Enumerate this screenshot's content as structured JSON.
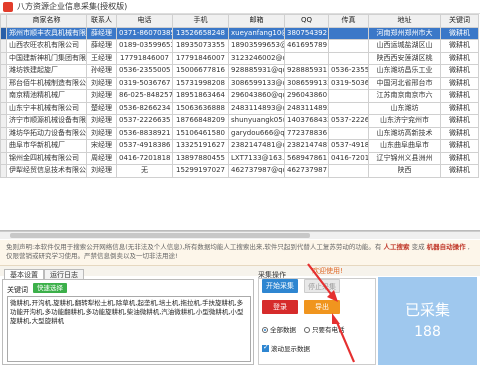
{
  "window": {
    "title": "八方资源企业信息采集(授权版)"
  },
  "table": {
    "columns": [
      "商家名称",
      "联系人",
      "电话",
      "手机",
      "邮箱",
      "QQ",
      "传真",
      "地址",
      "关键词"
    ],
    "rows": [
      [
        "郑州市顺丰农具机械有限公司",
        "薛经理",
        "0371-86070385",
        "13526658248",
        "xueyanfang10@qq",
        "380754392",
        "",
        "河南郑州郑州市大",
        "微耕机"
      ],
      [
        "山西农旺农机有限公司",
        "薛经理",
        "0189-03599653",
        "18935073355",
        "18903599653@",
        "461695789",
        "",
        "山西运城盐湖区山",
        "微耕机"
      ],
      [
        "中国建新神机门集团有限",
        "王经理",
        "17791846007",
        "17791846007",
        "3123246002@qq",
        "",
        "",
        "陕西西安莲湖区桃",
        "微耕机"
      ],
      [
        "潍坊铁建起旋厂",
        "孙经理",
        "0536-2355005",
        "15006677816",
        "928885931@qq.",
        "928885931",
        "0536-235500",
        "山东潍坊昌乐工业",
        "微耕机"
      ],
      [
        "邢台佰牛机械制造有限公司",
        "刘经理",
        "0319-5036767",
        "15731998208",
        "3086599133@qq",
        "3086599133",
        "0319-503676",
        "中国河北省邢台市",
        "微耕机"
      ],
      [
        "南京精池精机械厂",
        "刘经理",
        "86-025-8482578",
        "18951863464",
        "296043860@qq",
        "296043860",
        "",
        "江苏南京南京市六",
        "微耕机"
      ],
      [
        "山东宁丰机械有限公司",
        "楚经理",
        "0536-8266234",
        "15063636888",
        "2483114893@qq",
        "2483114893",
        "",
        "山东潍坊",
        "微耕机"
      ],
      [
        "济宁市顺源机械设备有限",
        "刘经理",
        "0537-2226635",
        "18766848209",
        "shunyuangk05@",
        "1403768432",
        "0537-222663",
        "山东济宁兖州市",
        "微耕机"
      ],
      [
        "潍坊华拓动力设备有限公",
        "刘经理",
        "0536-8838921",
        "15106461580",
        "garydou666@qq",
        "772378836",
        "",
        "山东潍坊高新技术",
        "微耕机"
      ],
      [
        "曲阜市华新机械厂",
        "宋经理",
        "0537-4918386",
        "13325191627",
        "2382147481@qq",
        "2382147481",
        "0537-491838",
        "山东曲阜曲阜市",
        "微耕机"
      ],
      [
        "锦州金四机械有限公司",
        "周经理",
        "0416-7201818",
        "13897880455",
        "LXT7133@163.C",
        "568947861",
        "0416-720181",
        "辽宁锦州义县洲州",
        "微耕机"
      ],
      [
        "伊犁经贸信息技术有限公",
        "刘经理",
        "无",
        "15299197027",
        "462737987@qq",
        "462737987",
        "",
        "陕西",
        "微耕机"
      ]
    ],
    "selected_row": 0
  },
  "disclaimer": {
    "line1": "免则声明:本软件仅用于搜索公开网络信息(无非法及个人信息),所有数据均能人工搜索出来,软件只起到代替人工复苏劳动的功能。有",
    "highlight1": "人工搜索",
    "mid": "变成",
    "highlight2": "机器自动操作",
    "line2_rest": ",仅限营销或研究学习使用。严禁信息倒卖以及一切非法用途!",
    "welcome": "欢迎使用!"
  },
  "tabs": [
    {
      "label": "基本设置",
      "active": true
    },
    {
      "label": "运行日志",
      "active": false
    }
  ],
  "settings": {
    "keyword_label": "关键词",
    "quick_button": "快速选择",
    "keywords": "微耕机,开沟机,旋耕机,翻转犁松土机,除草机,起垄机,培土机,拖拉机,手扶旋耕机,多功能开沟机,多功能翻耕机,多功能旋耕机,柴油微耕机,汽油微耕机,小型微耕机,小型旋耕机,大型旋耕机"
  },
  "ops": {
    "label": "采集操作",
    "start": "开始采集",
    "stop": "停止采集",
    "login": "登录",
    "export": "导出",
    "radio_all": "全部数据",
    "radio_phone": "只要有电话",
    "scroll_label": "滚动显示数据"
  },
  "counter": {
    "label": "已采集",
    "count": "188"
  },
  "colors": {
    "selected_row": "#3b78c8",
    "start": "#2e86d1",
    "login": "#d62b2b",
    "export": "#f0951e",
    "counter": "#9fc8ee",
    "quick": "#3cb04a",
    "arrow": "#e53030"
  }
}
